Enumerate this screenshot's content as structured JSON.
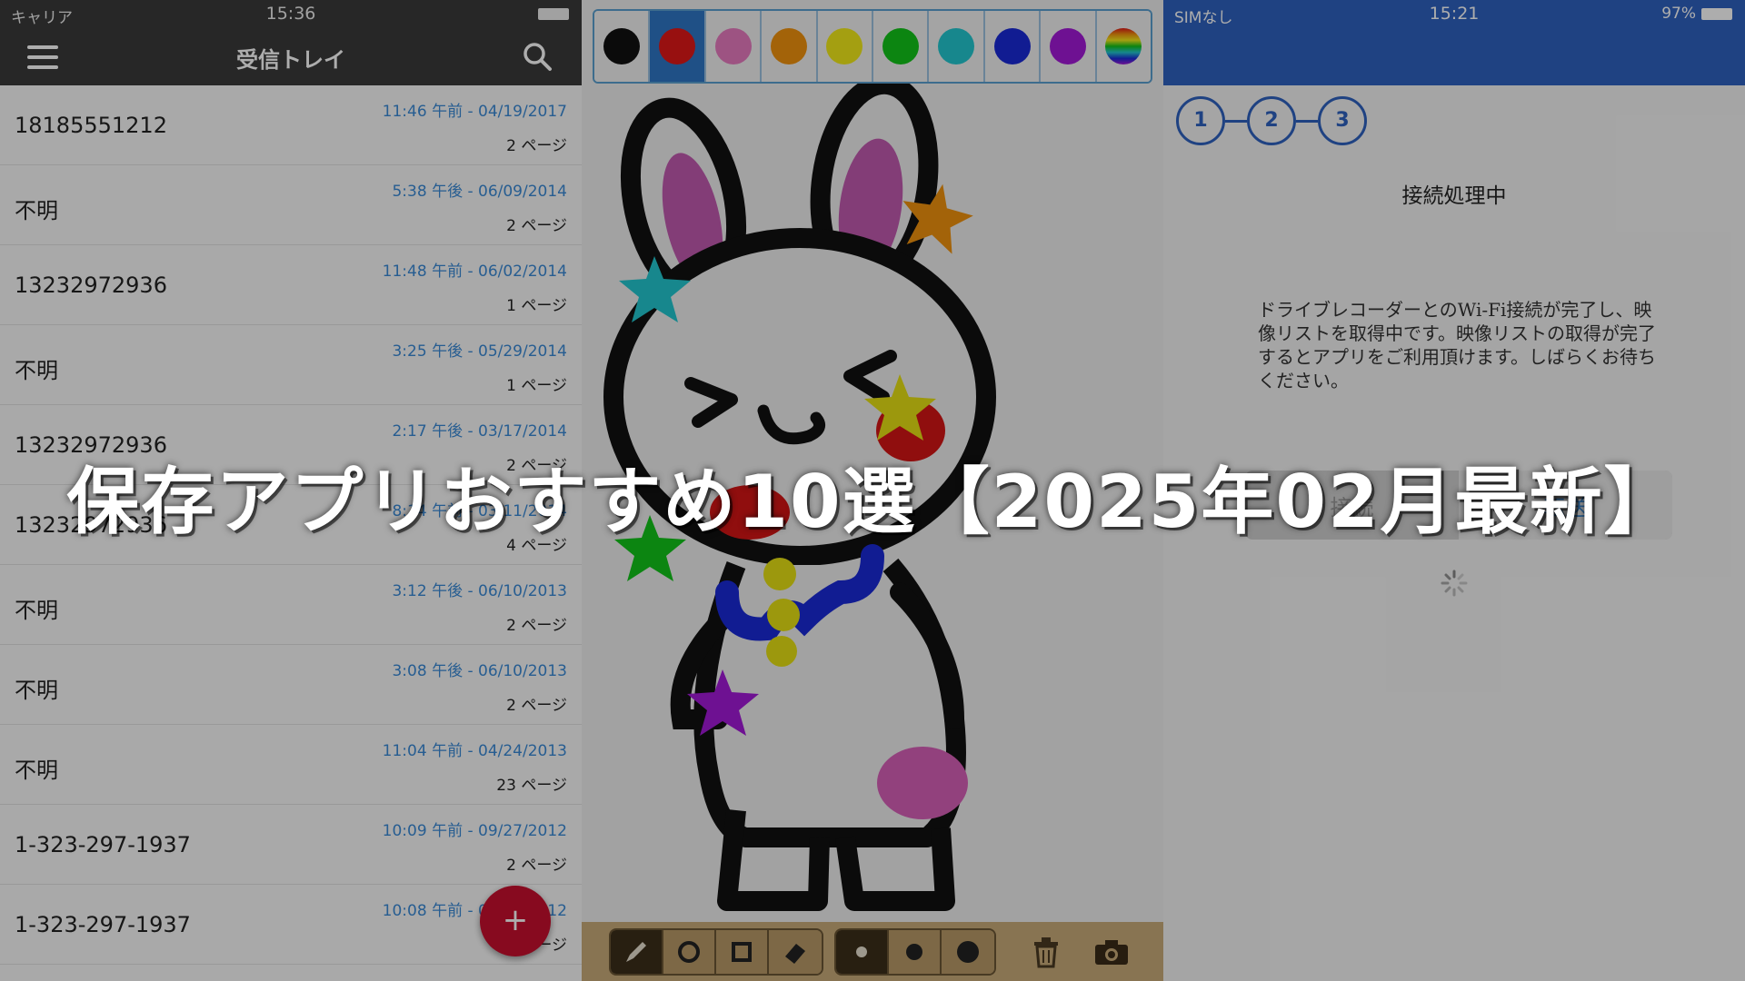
{
  "headline": "保存アプリおすすめ10選【2025年02月最新】",
  "fax_app": {
    "status_bar": {
      "carrier": "キャリア",
      "time": "15:36"
    },
    "header": {
      "title": "受信トレイ",
      "menu_icon": "hamburger-icon",
      "search_icon": "search-icon"
    },
    "messages": [
      {
        "from": "18185551212",
        "date": "11:46 午前 - 04/19/2017",
        "pages": "2 ページ"
      },
      {
        "from": "不明",
        "date": "5:38 午後 - 06/09/2014",
        "pages": "2 ページ"
      },
      {
        "from": "13232972936",
        "date": "11:48 午前 - 06/02/2014",
        "pages": "1 ページ"
      },
      {
        "from": "不明",
        "date": "3:25 午後 - 05/29/2014",
        "pages": "1 ページ"
      },
      {
        "from": "13232972936",
        "date": "2:17 午後 - 03/17/2014",
        "pages": "2 ページ"
      },
      {
        "from": "13232972936",
        "date": "8:14 午前 - 03/11/2014",
        "pages": "4 ページ"
      },
      {
        "from": "不明",
        "date": "3:12 午後 - 06/10/2013",
        "pages": "2 ページ"
      },
      {
        "from": "不明",
        "date": "3:08 午後 - 06/10/2013",
        "pages": "2 ページ"
      },
      {
        "from": "不明",
        "date": "11:04 午前 - 04/24/2013",
        "pages": "23 ページ"
      },
      {
        "from": "1-323-297-1937",
        "date": "10:09 午前 - 09/27/2012",
        "pages": "2 ページ"
      },
      {
        "from": "1-323-297-1937",
        "date": "10:08 午前 - 09/27/2012",
        "pages": "2 ページ"
      }
    ],
    "fab_label": "+"
  },
  "drawing_app": {
    "palette": [
      {
        "name": "black",
        "color": "#111111"
      },
      {
        "name": "red",
        "color": "#e01818",
        "selected": true
      },
      {
        "name": "pink",
        "color": "#e77bc0"
      },
      {
        "name": "orange",
        "color": "#f0930e"
      },
      {
        "name": "yellow",
        "color": "#f2ea1a"
      },
      {
        "name": "green",
        "color": "#12c41a"
      },
      {
        "name": "cyan",
        "color": "#22c8d0"
      },
      {
        "name": "blue",
        "color": "#1a2ad8"
      },
      {
        "name": "purple",
        "color": "#a21ad8"
      },
      {
        "name": "rainbow",
        "color": "rainbow"
      }
    ],
    "tools": [
      "pencil-icon",
      "circle-icon",
      "square-icon",
      "eraser-icon"
    ],
    "brush_sizes": [
      "small",
      "medium",
      "large"
    ],
    "actions": [
      "trash-icon",
      "camera-icon"
    ],
    "drawing_colors": {
      "outline": "#111111",
      "ears": "#c25bb0",
      "cheeks": "#d41616",
      "collar": "#1a2ad8",
      "buttons": "#e6e014",
      "star_orange": "#f0930e",
      "star_cyan": "#22c8d0",
      "star_green": "#12c41a",
      "star_purple": "#a21ad8",
      "hand_pink": "#d860b8"
    }
  },
  "wifi_app": {
    "status_bar": {
      "carrier": "SIMなし",
      "time": "15:21",
      "battery": "97%"
    },
    "steps": [
      "1",
      "2",
      "3"
    ],
    "title": "接続処理中",
    "message": "ドライブレコーダーとのWi-Fi接続が完了し、映像リストを取得中です。映像リストの取得が完了するとアプリをご利用頂けます。しばらくお待ちください。",
    "tabs": [
      "接続",
      "転送"
    ]
  }
}
